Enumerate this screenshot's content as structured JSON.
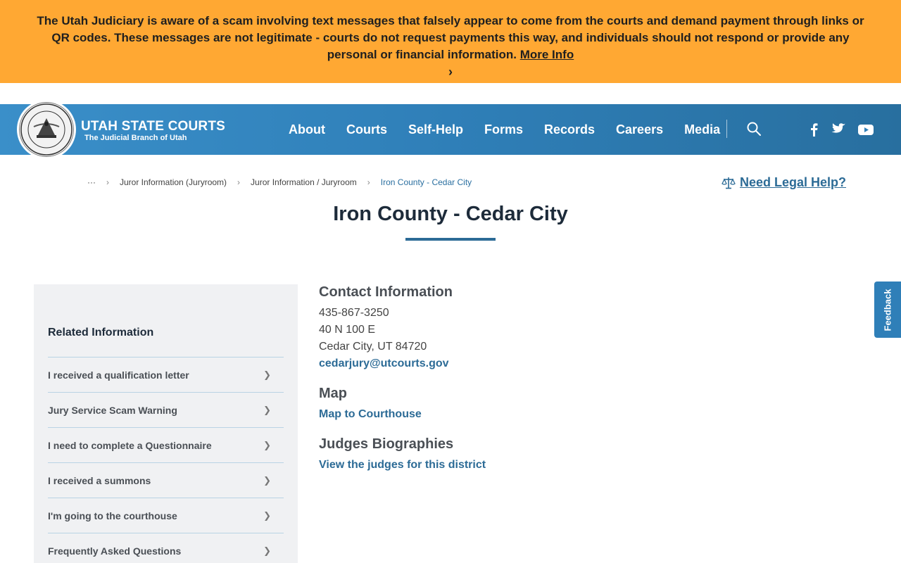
{
  "alert": {
    "message": "The Utah Judiciary is aware of a scam involving text messages that falsely appear to come from the courts and demand payment through links or QR codes. These messages are not legitimate - courts do not request payments this way, and individuals should not respond or provide any personal or financial information.",
    "link_label": "More Info",
    "chevron": "›"
  },
  "header": {
    "seal_text_top": "STATE OF UTAH",
    "seal_text_bottom": "JUDICIARY",
    "title": "UTAH STATE COURTS",
    "subtitle": "The Judicial Branch of Utah",
    "nav": [
      "About",
      "Courts",
      "Self-Help",
      "Forms",
      "Records",
      "Careers",
      "Media"
    ]
  },
  "breadcrumb": {
    "ellipsis": "···",
    "items": [
      "Juror Information (Juryroom)",
      "Juror Information / Juryroom"
    ],
    "current": "Iron County - Cedar City",
    "separator": "›"
  },
  "legal_help": "Need Legal Help?",
  "page_title": "Iron County - Cedar City",
  "sidebar": {
    "heading": "Related Information",
    "items": [
      "I received a qualification letter",
      "Jury Service Scam Warning",
      "I need to complete a Questionnaire",
      "I received a summons",
      "I'm going to the courthouse",
      "Frequently Asked Questions"
    ]
  },
  "contact": {
    "heading": "Contact Information",
    "phone": "435-867-3250",
    "address1": "40 N 100 E",
    "address2": "Cedar City, UT 84720",
    "email": "cedarjury@utcourts.gov"
  },
  "map": {
    "heading": "Map",
    "link": "Map to Courthouse"
  },
  "judges": {
    "heading": "Judges Biographies",
    "link": "View the judges for this district"
  },
  "feedback": "Feedback",
  "colors": {
    "alert_bg": "#ffa833",
    "header_blue": "#2f7fb8",
    "link_blue": "#2c6b96",
    "sidebar_bg": "#f0f1f3"
  }
}
